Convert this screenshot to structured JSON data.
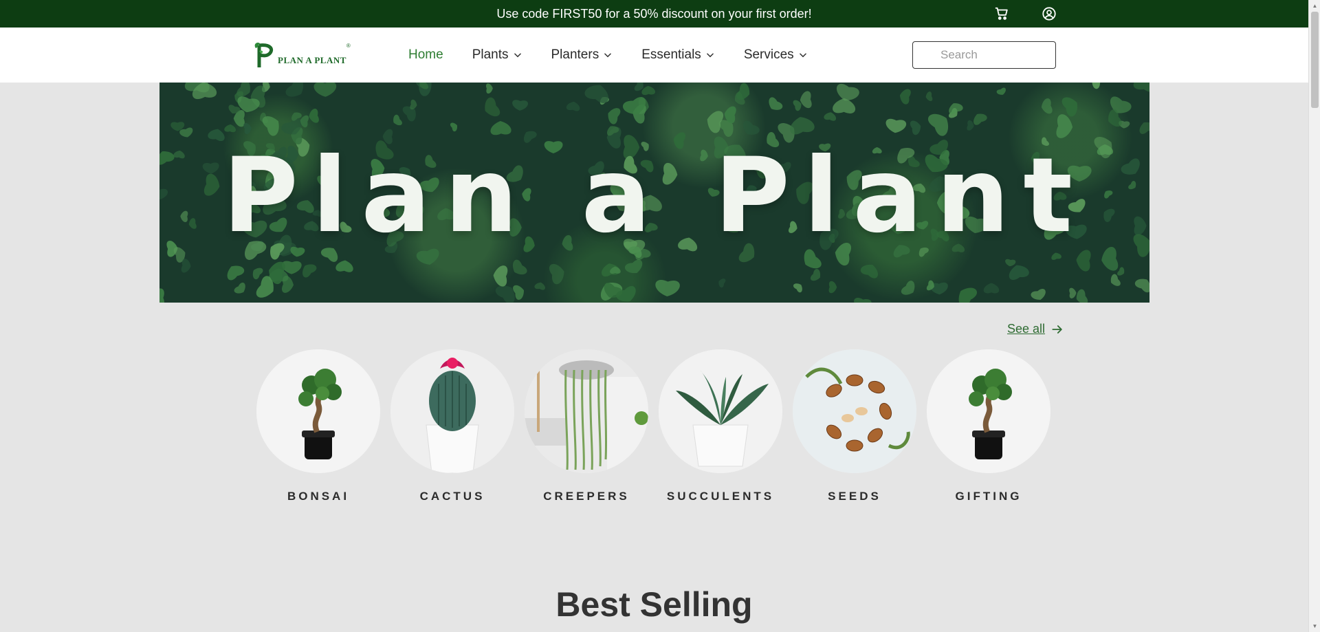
{
  "announcement": {
    "text": "Use code FIRST50 for a 50% discount on your first order!",
    "icons": [
      "cart-icon",
      "account-icon"
    ]
  },
  "brand": {
    "name": "PLAN A PLANT",
    "registered": "®",
    "color": "#1f6a2a"
  },
  "nav": {
    "items": [
      {
        "label": "Home",
        "active": true,
        "dropdown": false
      },
      {
        "label": "Plants",
        "active": false,
        "dropdown": true
      },
      {
        "label": "Planters",
        "active": false,
        "dropdown": true
      },
      {
        "label": "Essentials",
        "active": false,
        "dropdown": true
      },
      {
        "label": "Services",
        "active": false,
        "dropdown": true
      }
    ],
    "active_color": "#2e7d32"
  },
  "search": {
    "placeholder": "Search",
    "value": ""
  },
  "hero": {
    "title": "Plan a Plant"
  },
  "see_all": {
    "label": "See all"
  },
  "categories": [
    {
      "label": "BONSAI",
      "image": "bonsai-image"
    },
    {
      "label": "CACTUS",
      "image": "cactus-image"
    },
    {
      "label": "CREEPERS",
      "image": "creepers-image"
    },
    {
      "label": "SUCCULENTS",
      "image": "succulents-image"
    },
    {
      "label": "SEEDS",
      "image": "seeds-image"
    },
    {
      "label": "GIFTING",
      "image": "gifting-image"
    }
  ],
  "section": {
    "best_selling": "Best Selling"
  },
  "colors": {
    "announcement_bg": "#0d3d12",
    "page_bg": "#e5e5e5",
    "link": "#2e6b32"
  }
}
